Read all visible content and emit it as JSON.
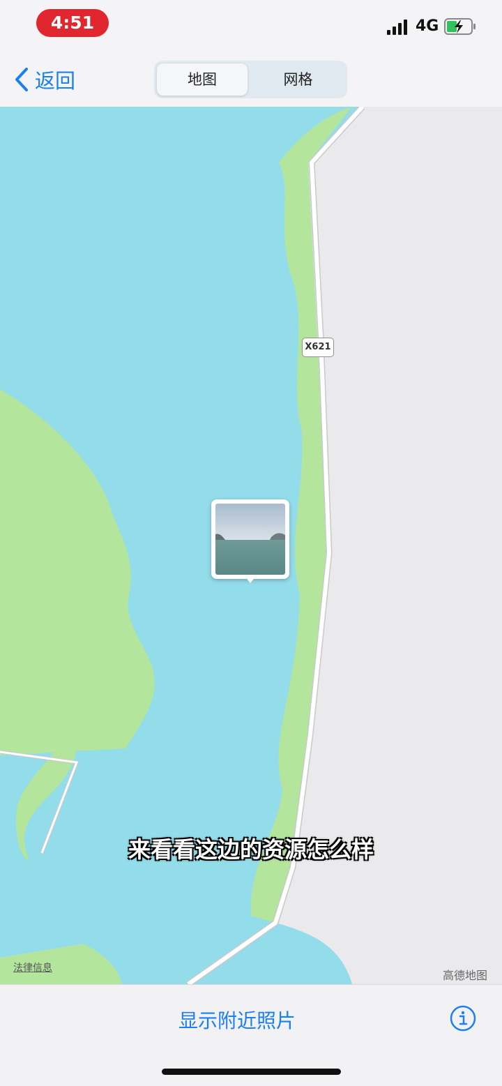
{
  "status_bar": {
    "time": "4:51",
    "network": "4G",
    "icons": [
      "signal-icon",
      "battery-charging-icon"
    ]
  },
  "nav": {
    "back_label": "返回",
    "tabs": [
      {
        "label": "地图",
        "selected": true
      },
      {
        "label": "网格",
        "selected": false
      }
    ]
  },
  "map": {
    "route_label": "X621",
    "legal_link": "法律信息",
    "provider": "高德地图",
    "subtitle": "来看看这边的资源怎么样",
    "colors": {
      "water": "#93dcea",
      "land": "#eaeaec",
      "park": "#b3e69c",
      "road": "#ffffff"
    }
  },
  "toolbar": {
    "nearby_label": "显示附近照片",
    "info_icon": "info-icon"
  },
  "colors": {
    "accent": "#1a7ff0",
    "time_pill": "#e0262e"
  }
}
